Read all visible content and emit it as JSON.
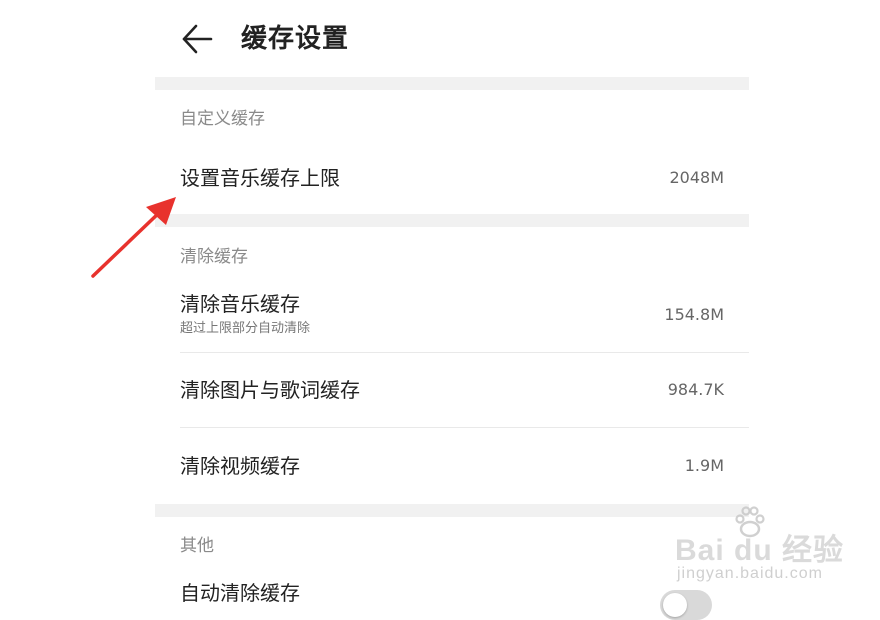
{
  "header": {
    "title": "缓存设置"
  },
  "custom_cache": {
    "section_title": "自定义缓存",
    "limit_row": {
      "label": "设置音乐缓存上限",
      "value": "2048M"
    }
  },
  "clear_cache": {
    "section_title": "清除缓存",
    "rows": [
      {
        "label": "清除音乐缓存",
        "sublabel": "超过上限部分自动清除",
        "value": "154.8M"
      },
      {
        "label": "清除图片与歌词缓存",
        "value": "984.7K"
      },
      {
        "label": "清除视频缓存",
        "value": "1.9M"
      }
    ]
  },
  "other": {
    "section_title": "其他",
    "auto_clear_row": {
      "label": "自动清除缓存",
      "toggle_on": false
    }
  },
  "annotation": {
    "arrow_color": "#e8322d"
  },
  "watermark": {
    "main": "Bai du 经验",
    "sub": "jingyan.baidu.com"
  }
}
